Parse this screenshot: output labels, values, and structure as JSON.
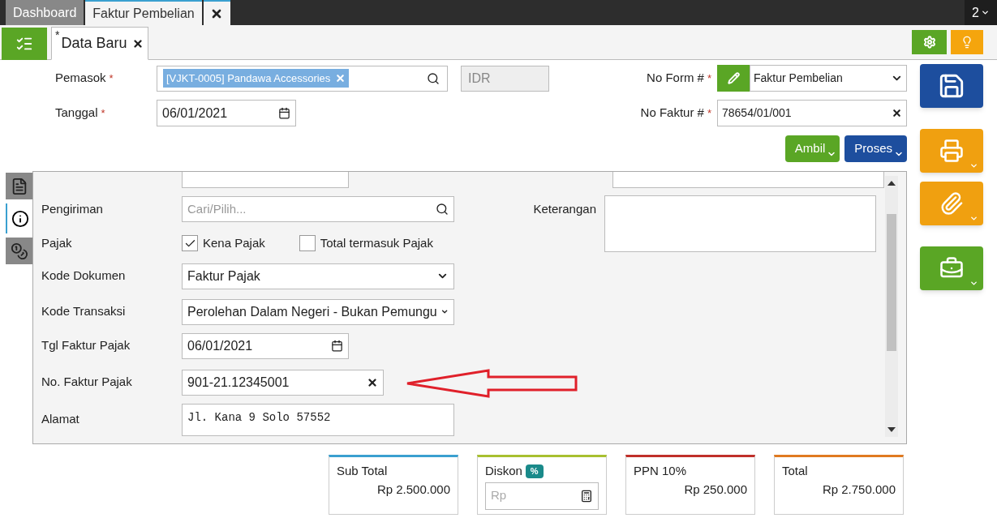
{
  "top_tabs": [
    {
      "label": "Dashboard",
      "selected": false
    },
    {
      "label": "Faktur Pembelian",
      "selected": true
    }
  ],
  "tab_count": "2",
  "doc_tab": {
    "mark": "*",
    "label": "Data Baru"
  },
  "header": {
    "supplier_label": "Pemasok",
    "supplier_tag": "[VJKT-0005] Pandawa Accessories",
    "currency": "IDR",
    "date_label": "Tanggal",
    "date": "06/01/2021",
    "form_label": "No Form #",
    "form_value": "Faktur Pembelian",
    "invoice_label": "No Faktur #",
    "invoice_value": "78654/01/001"
  },
  "actions": [
    "Ambil",
    "Proses"
  ],
  "side_tabs": [
    {
      "kind": "list",
      "selected": false
    },
    {
      "kind": "info",
      "selected": true
    },
    {
      "kind": "money",
      "selected": false
    }
  ],
  "fields": [
    {
      "kind": "search",
      "label": "Pengiriman",
      "placeholder": "Cari/Pilih..."
    },
    {
      "kind": "checks",
      "label": "Pajak",
      "options": [
        {
          "label": "Kena Pajak",
          "checked": true
        },
        {
          "label": "Total termasuk Pajak",
          "checked": false
        }
      ]
    },
    {
      "kind": "select",
      "label": "Kode Dokumen",
      "value": "Faktur Pajak"
    },
    {
      "kind": "select",
      "label": "Kode Transaksi",
      "value": "Perolehan Dalam Negeri - Bukan Pemungu"
    },
    {
      "kind": "date",
      "label": "Tgl Faktur Pajak",
      "value": "06/01/2021"
    },
    {
      "kind": "clearable",
      "label": "No. Faktur Pajak",
      "value": "901-21.12345001"
    },
    {
      "kind": "textarea",
      "label": "Alamat",
      "value": "Jl. Kana 9 Solo 57552"
    }
  ],
  "remarks": {
    "label": "Keterangan"
  },
  "totals": [
    {
      "kind": "value",
      "label": "Sub Total",
      "value": "Rp 2.500.000",
      "color": "#3aa0d0"
    },
    {
      "kind": "discount",
      "label": "Diskon",
      "badge": "%",
      "placeholder": "Rp",
      "color": "#a8c030"
    },
    {
      "kind": "value",
      "label": "PPN 10%",
      "value": "Rp 250.000",
      "color": "#c0302a"
    },
    {
      "kind": "value",
      "label": "Total",
      "value": "Rp 2.750.000",
      "color": "#e07a20"
    }
  ]
}
